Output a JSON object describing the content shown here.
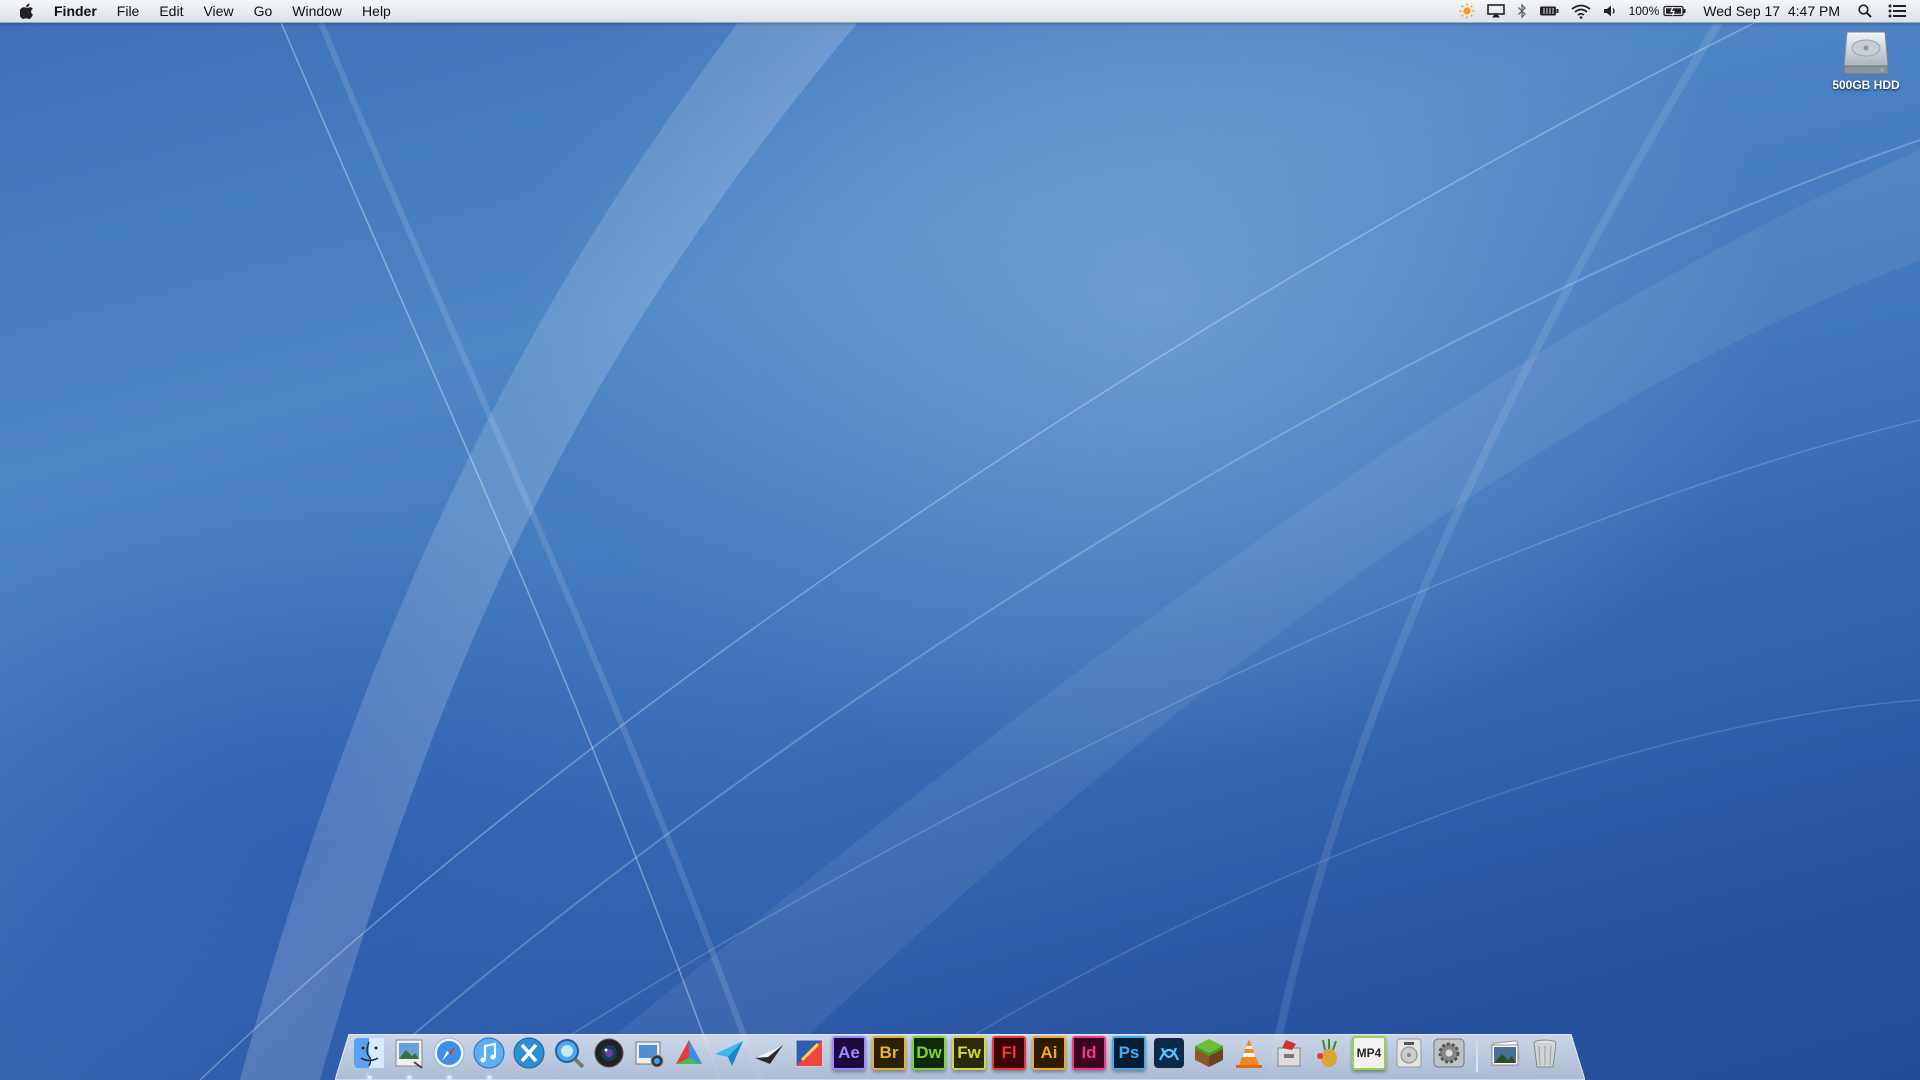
{
  "menubar": {
    "app_name": "Finder",
    "menus": [
      "File",
      "Edit",
      "View",
      "Go",
      "Window",
      "Help"
    ],
    "status": {
      "battery_percent": "100%",
      "datetime": "Wed Sep 17  4:47 PM"
    }
  },
  "desktop": {
    "hdd_label": "500GB HDD"
  },
  "dock": {
    "tiles": {
      "ae": "Ae",
      "br": "Br",
      "dw": "Dw",
      "fw": "Fw",
      "fl": "Fl",
      "ai": "Ai",
      "id": "Id",
      "ps": "Ps",
      "mp4": "MP4"
    }
  },
  "colors": {
    "ae": "#9a8bff",
    "br": "#e3b526",
    "dw": "#7fd33c",
    "fw": "#d6d63a",
    "fl": "#e8383a",
    "ai": "#f1a92b",
    "id": "#ef3a8e",
    "ps": "#4aa8ee"
  }
}
